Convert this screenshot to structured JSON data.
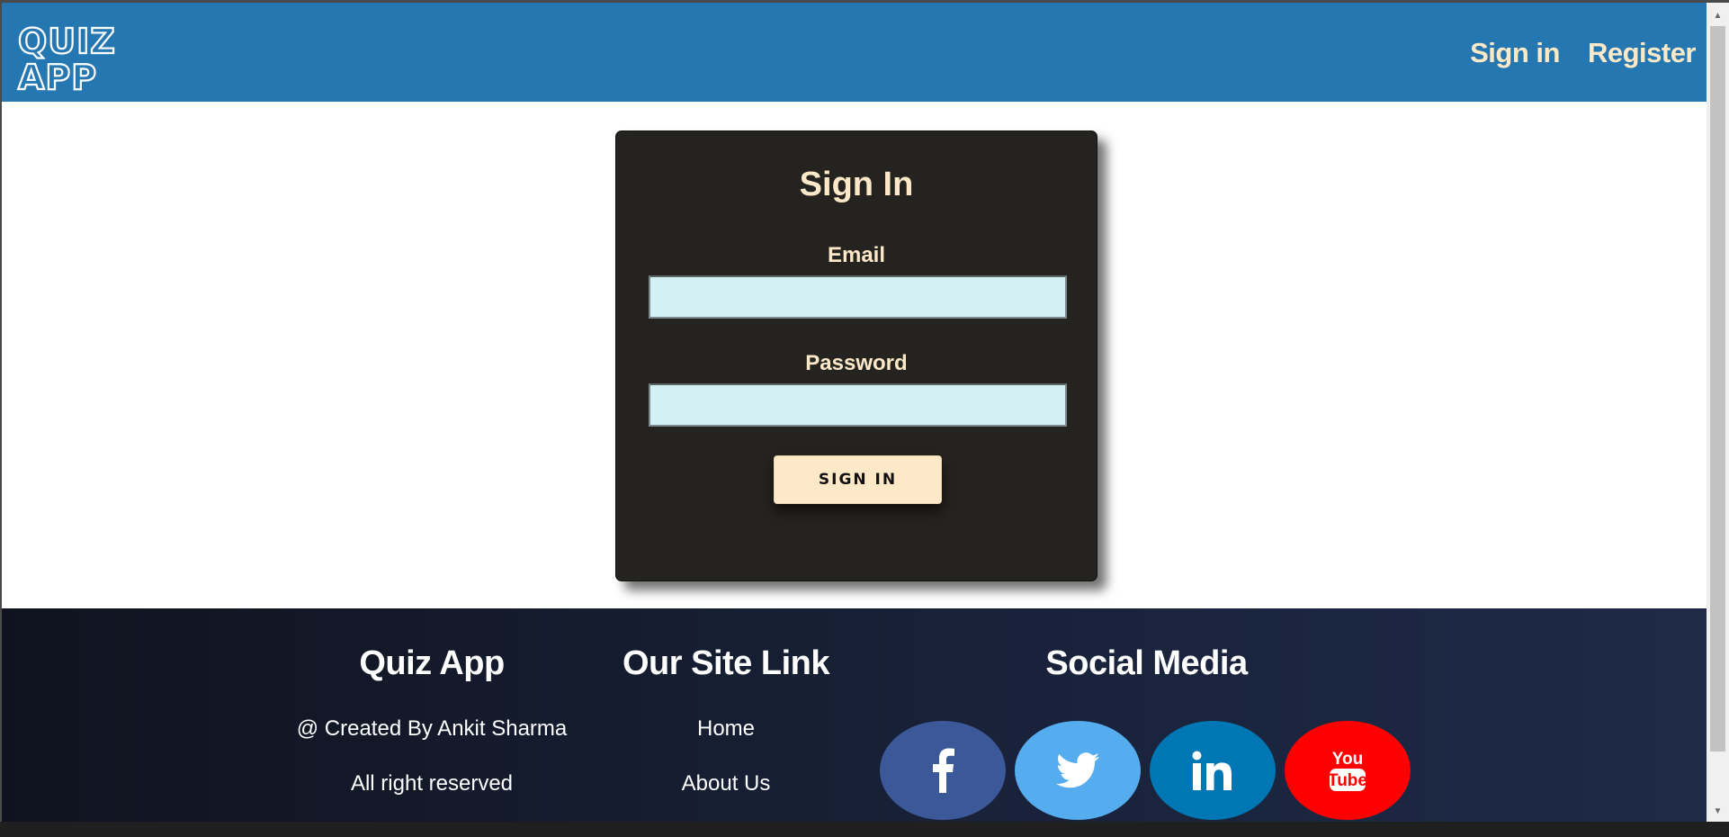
{
  "header": {
    "logo_line1": "QUIZ",
    "logo_line2": "APP",
    "nav": [
      {
        "label": "Sign in"
      },
      {
        "label": "Register"
      }
    ],
    "background": "#2577b2",
    "nav_color": "#fde9c7"
  },
  "form": {
    "title": "Sign In",
    "email_label": "Email",
    "email_value": "",
    "password_label": "Password",
    "password_value": "",
    "submit_label": "SIGN IN",
    "card_color": "#252320",
    "input_color": "#d3f0f3"
  },
  "footer": {
    "col1_title": "Quiz App",
    "col1_lines": [
      "@ Created By Ankit Sharma",
      "All right reserved"
    ],
    "col2_title": "Our Site Link",
    "col2_links": [
      "Home",
      "About Us"
    ],
    "col3_title": "Social Media",
    "social": [
      {
        "name": "facebook-icon",
        "color": "#3b5998"
      },
      {
        "name": "twitter-icon",
        "color": "#55acee"
      },
      {
        "name": "linkedin-icon",
        "color": "#0077b5"
      },
      {
        "name": "youtube-icon",
        "color": "#ff0000"
      }
    ],
    "youtube_text": [
      "You",
      "Tube"
    ]
  }
}
